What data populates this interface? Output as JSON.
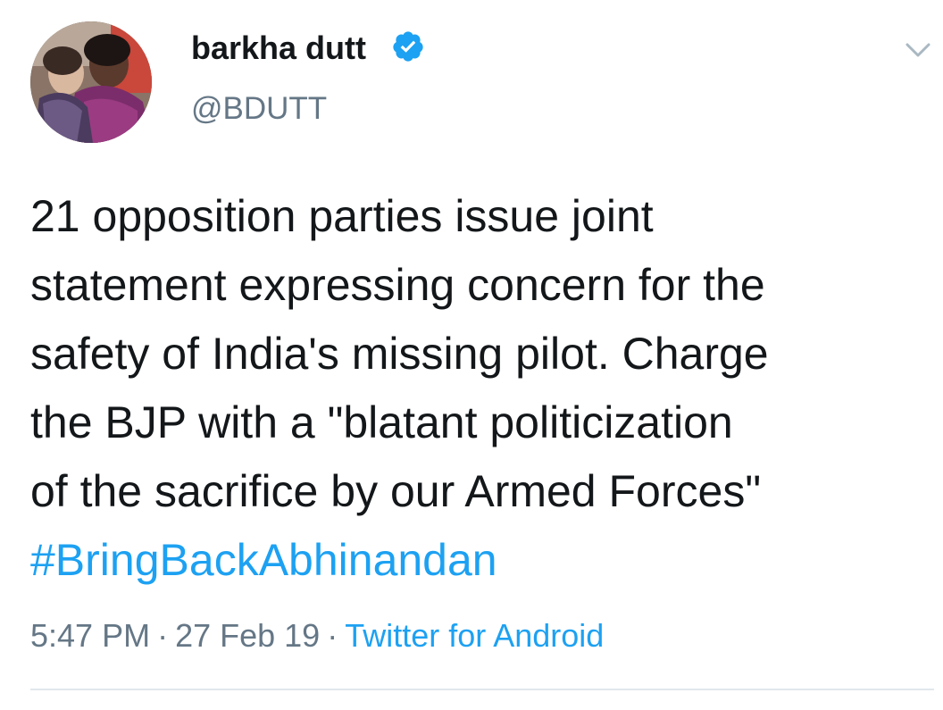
{
  "user": {
    "display_name": "barkha dutt",
    "handle": "@BDUTT",
    "verified": true,
    "avatar_icon": "profile-photo"
  },
  "tweet": {
    "lines": [
      "21 opposition parties issue joint",
      "statement expressing concern for the",
      "safety of India's missing pilot. Charge",
      "the BJP with a \"blatant politicization",
      "of the sacrifice by our Armed Forces\""
    ],
    "hashtag": "#BringBackAbhinandan"
  },
  "meta": {
    "time": "5:47 PM",
    "separator": "·",
    "date": "27 Feb 19",
    "source": "Twitter for Android"
  },
  "icons": {
    "verified": "verified-badge-icon",
    "menu": "chevron-down-icon"
  },
  "colors": {
    "link": "#1da1f2",
    "secondary_text": "#657786",
    "primary_text": "#14171a",
    "divider": "#e1e8ed"
  }
}
